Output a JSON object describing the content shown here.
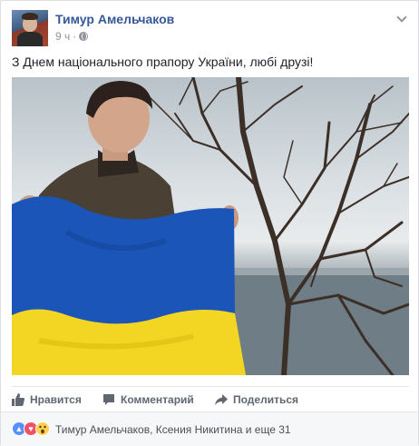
{
  "post": {
    "author_name": "Тимур Амельчаков",
    "time": "9 ч",
    "dot": "·",
    "text": "З Днем національного прапору України, любі друзі!"
  },
  "actions": {
    "like_label": "Нравится",
    "comment_label": "Комментарий",
    "share_label": "Поделиться"
  },
  "reactions": {
    "names": "Тимур Амельчаков, Ксения Никитина и еще 31",
    "types": [
      "like-icon",
      "love-icon",
      "wow-icon"
    ]
  },
  "colors": {
    "link": "#365899",
    "flag_blue": "#1b55b8",
    "flag_yellow": "#f3d624"
  }
}
